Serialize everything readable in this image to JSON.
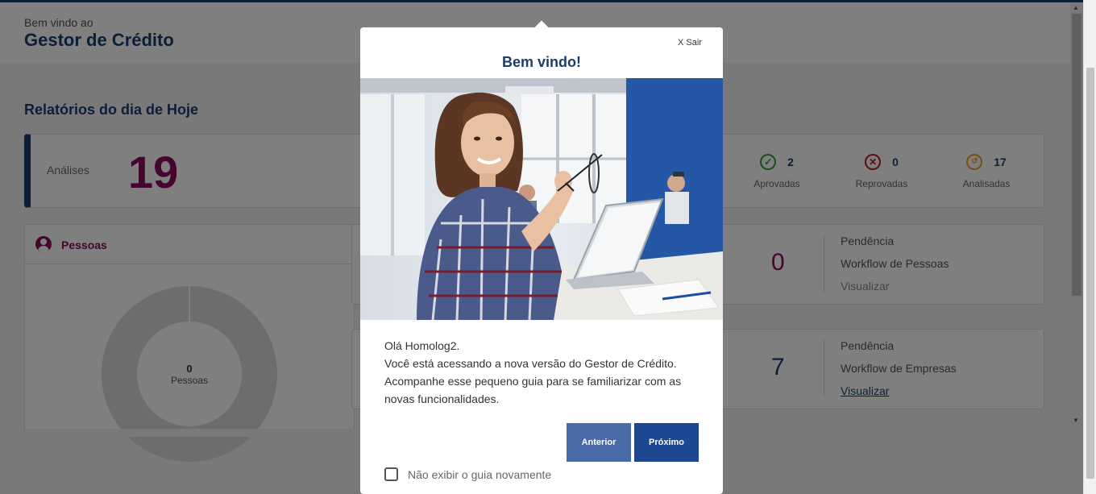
{
  "header": {
    "subtitle": "Bem vindo ao",
    "title": "Gestor de Crédito"
  },
  "section_title": "Relatórios do dia de Hoje",
  "analises": {
    "label": "Análises",
    "count": "19",
    "stats": [
      {
        "value": "2",
        "label": "Aprovadas",
        "icon": "check-circle-icon",
        "color": "#2e9e3e"
      },
      {
        "value": "0",
        "label": "Reprovadas",
        "icon": "x-circle-icon",
        "color": "#c21a1a"
      },
      {
        "value": "17",
        "label": "Analisadas",
        "icon": "history-icon",
        "color": "#e8a020"
      }
    ]
  },
  "pessoas_card": {
    "title": "Pessoas",
    "donut_value": "0",
    "donut_label": "Pessoas",
    "accent": "#8b0a5a"
  },
  "workflow_pessoas": {
    "count": "0",
    "line1": "Pendência",
    "line2": "Workflow de Pessoas",
    "link": "Visualizar",
    "count_color": "#8b0a5a"
  },
  "workflow_empresas": {
    "count": "7",
    "line1": "Pendência",
    "line2": "Workflow de Empresas",
    "link": "Visualizar",
    "count_color": "#1b3d6e"
  },
  "modal": {
    "close_label": "X Sair",
    "title": "Bem vindo!",
    "greeting": "Olá Homolog2.",
    "body_line1": "Você está acessando a nova versão do Gestor de Crédito.",
    "body_line2": "Acompanhe esse pequeno guia para se familiarizar com as novas funcionalidades.",
    "prev_label": "Anterior",
    "next_label": "Próximo",
    "checkbox_label": "Não exibir o guia novamente",
    "checkbox_checked": false
  }
}
